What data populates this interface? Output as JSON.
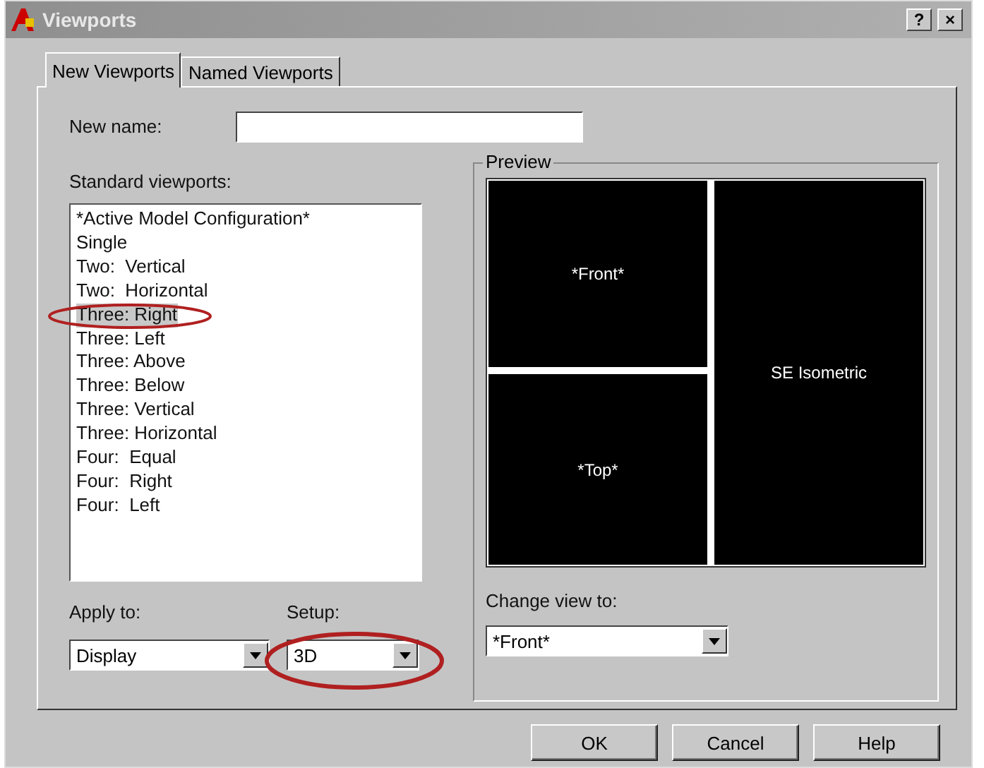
{
  "window": {
    "title": "Viewports",
    "buttons": [
      "?",
      "×"
    ]
  },
  "tabs": [
    {
      "label": "New Viewports",
      "selected": true
    },
    {
      "label": "Named Viewports",
      "selected": false
    }
  ],
  "new_name": {
    "label": "New name:"
  },
  "standard_viewports": {
    "label": "Standard viewports:",
    "items": [
      {
        "label": "*Active Model Configuration*",
        "selected": false
      },
      {
        "label": "Single",
        "selected": false
      },
      {
        "label": "Two:  Vertical",
        "selected": false
      },
      {
        "label": "Two:  Horizontal",
        "selected": false
      },
      {
        "label": "Three: Right",
        "selected": true
      },
      {
        "label": "Three: Left",
        "selected": false
      },
      {
        "label": "Three: Above",
        "selected": false
      },
      {
        "label": "Three: Below",
        "selected": false
      },
      {
        "label": "Three: Vertical",
        "selected": false
      },
      {
        "label": "Three: Horizontal",
        "selected": false
      },
      {
        "label": "Four:  Equal",
        "selected": false
      },
      {
        "label": "Four:  Right",
        "selected": false
      },
      {
        "label": "Four:  Left",
        "selected": false
      }
    ]
  },
  "preview": {
    "label": "Preview",
    "viewports": [
      "*Front*",
      "*Top*",
      "SE Isometric"
    ]
  },
  "apply_to": {
    "label": "Apply to:",
    "value": "Display"
  },
  "setup": {
    "label": "Setup:",
    "value": "3D"
  },
  "change_view_to": {
    "label": "Change view to:",
    "value": "*Front*"
  },
  "buttons": [
    "OK",
    "Cancel",
    "Help"
  ]
}
